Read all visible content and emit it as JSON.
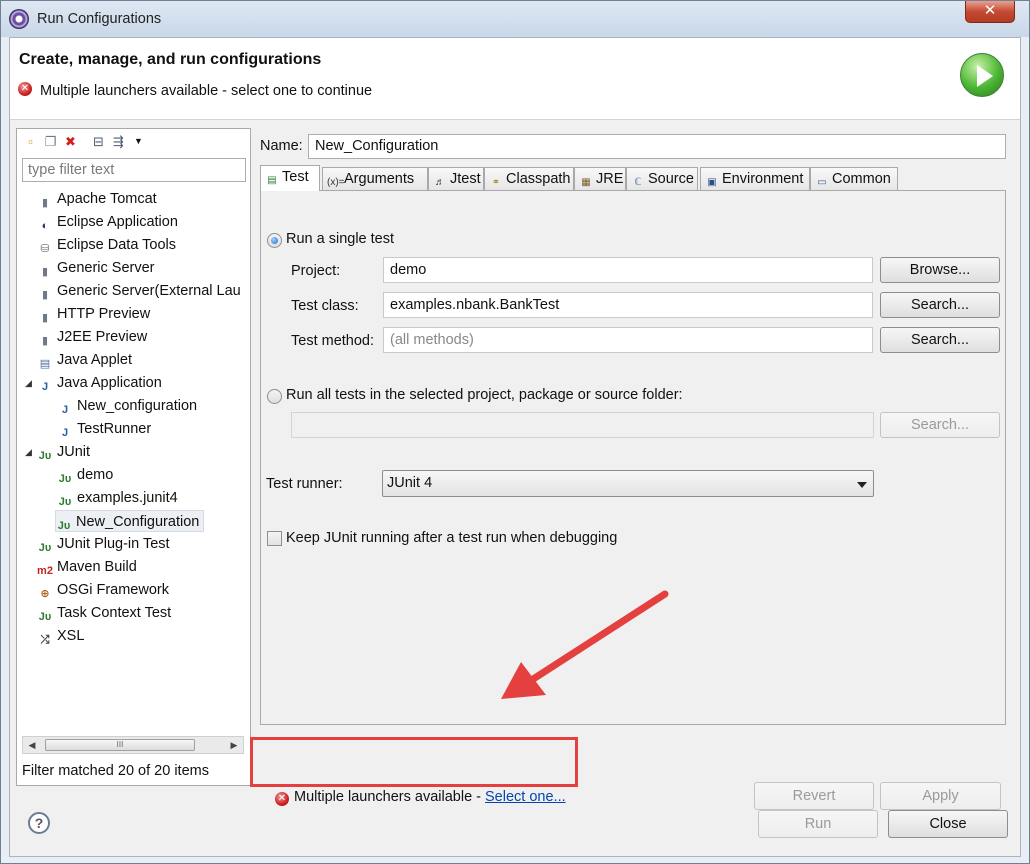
{
  "window": {
    "title": "Run Configurations",
    "close_label": "✕"
  },
  "header": {
    "title": "Create, manage, and run configurations",
    "message": "Multiple launchers available - select one to continue"
  },
  "left": {
    "filter_placeholder": "type filter text",
    "tree": [
      {
        "label": "Apache Tomcat",
        "icon": "server-icon"
      },
      {
        "label": "Eclipse Application",
        "icon": "eclipse-icon"
      },
      {
        "label": "Eclipse Data Tools",
        "icon": "database-icon"
      },
      {
        "label": "Generic Server",
        "icon": "server-icon"
      },
      {
        "label": "Generic Server(External Lau",
        "icon": "server-icon"
      },
      {
        "label": "HTTP Preview",
        "icon": "server-icon"
      },
      {
        "label": "J2EE Preview",
        "icon": "server-icon"
      },
      {
        "label": "Java Applet",
        "icon": "applet-icon"
      },
      {
        "label": "Java Application",
        "icon": "java-app-icon",
        "expanded": true
      },
      {
        "label": "New_configuration",
        "icon": "java-app-icon",
        "child": true
      },
      {
        "label": "TestRunner",
        "icon": "java-app-icon",
        "child": true
      },
      {
        "label": "JUnit",
        "icon": "junit-icon",
        "expanded": true
      },
      {
        "label": "demo",
        "icon": "junit-icon",
        "child": true
      },
      {
        "label": "examples.junit4",
        "icon": "junit-icon",
        "child": true
      },
      {
        "label": "New_Configuration",
        "icon": "junit-icon",
        "child": true,
        "selected": true
      },
      {
        "label": "JUnit Plug-in Test",
        "icon": "junit-plugin-icon"
      },
      {
        "label": "Maven Build",
        "icon": "maven-icon"
      },
      {
        "label": "OSGi Framework",
        "icon": "osgi-icon"
      },
      {
        "label": "Task Context Test",
        "icon": "task-context-icon"
      },
      {
        "label": "XSL",
        "icon": "xsl-icon"
      }
    ],
    "filter_status": "Filter matched 20 of 20 items"
  },
  "right": {
    "name_label": "Name:",
    "name_value": "New_Configuration",
    "tabs": [
      "Test",
      "Arguments",
      "Jtest",
      "Classpath",
      "JRE",
      "Source",
      "Environment",
      "Common"
    ],
    "run_single_label": "Run a single test",
    "project_label": "Project:",
    "project_value": "demo",
    "browse_label": "Browse...",
    "test_class_label": "Test class:",
    "test_class_value": "examples.nbank.BankTest",
    "search_label": "Search...",
    "test_method_label": "Test method:",
    "test_method_placeholder": "(all methods)",
    "run_all_label": "Run all tests in the selected project, package or source folder:",
    "test_runner_label": "Test runner:",
    "test_runner_value": "JUnit 4",
    "keep_running_label": "Keep JUnit running after a test run when debugging",
    "bottom_message": "Multiple launchers available - ",
    "select_one_link": "Select one...",
    "revert_label": "Revert",
    "apply_label": "Apply"
  },
  "footer": {
    "run_label": "Run",
    "close_label": "Close",
    "help_label": "?"
  },
  "colors": {
    "highlight": "#e3403f",
    "link": "#0645ad",
    "accent": "#1f6fd6"
  }
}
